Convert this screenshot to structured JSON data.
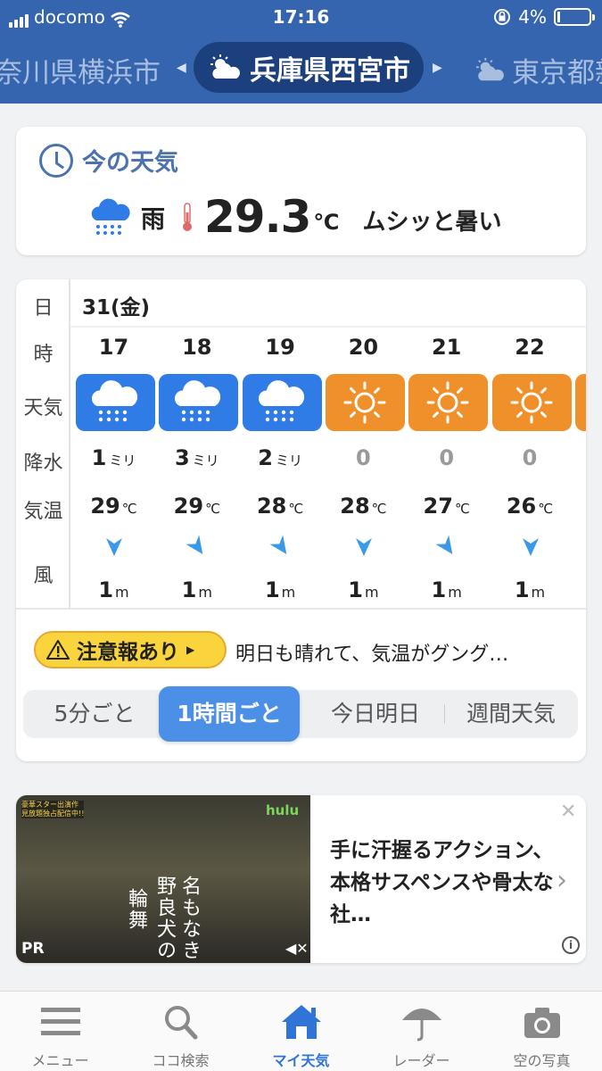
{
  "status": {
    "carrier": "docomo",
    "time": "17:16",
    "battery": "4%"
  },
  "cities": {
    "prev": "奈川県横浜市",
    "current": "兵庫県西宮市",
    "next": "東京都新"
  },
  "now": {
    "title": "今の天気",
    "condition": "雨",
    "temp": "29.3",
    "unit": "℃",
    "feel": "ムシッと暑い"
  },
  "hourly": {
    "date": "31(金)",
    "row_labels": {
      "day": "日",
      "hour": "時",
      "weather": "天気",
      "precip": "降水",
      "temp": "気温",
      "wind": "風"
    },
    "precip_unit": "ミリ",
    "temp_unit": "℃",
    "wind_unit": "m",
    "hours": [
      {
        "hour": "17",
        "weather": "rain",
        "precip": "1",
        "temp": "29",
        "wind": "1",
        "wind_dir": 0
      },
      {
        "hour": "18",
        "weather": "rain",
        "precip": "3",
        "temp": "29",
        "wind": "1",
        "wind_dir": -35
      },
      {
        "hour": "19",
        "weather": "rain",
        "precip": "2",
        "temp": "28",
        "wind": "1",
        "wind_dir": -35
      },
      {
        "hour": "20",
        "weather": "sun",
        "precip": "0",
        "temp": "28",
        "wind": "1",
        "wind_dir": 0
      },
      {
        "hour": "21",
        "weather": "sun",
        "precip": "0",
        "temp": "27",
        "wind": "1",
        "wind_dir": -35
      },
      {
        "hour": "22",
        "weather": "sun",
        "precip": "0",
        "temp": "26",
        "wind": "1",
        "wind_dir": 0
      }
    ]
  },
  "alert": {
    "label": "注意報あり",
    "text": "明日も晴れて、気温がグング…"
  },
  "segments": [
    "5分ごと",
    "1時間ごと",
    "今日明日",
    "週間天気"
  ],
  "ad": {
    "text": "手に汗握るアクション、本格サスペンスや骨太な社…",
    "brand": "hulu",
    "badge": "PR",
    "tag_line1": "豪華スター出演作",
    "tag_line2": "見放題独占配信中!!",
    "film_title_1": "名もなき",
    "film_title_2": "野良犬の",
    "film_title_3": "輪舞"
  },
  "tabs": [
    "メニュー",
    "ココ検索",
    "マイ天気",
    "レーダー",
    "空の写真"
  ],
  "colors": {
    "header": "#3665b0",
    "rain": "#2f7ce6",
    "sun": "#f0902b",
    "accent": "#4b8fe6",
    "alert": "#fad43c"
  }
}
